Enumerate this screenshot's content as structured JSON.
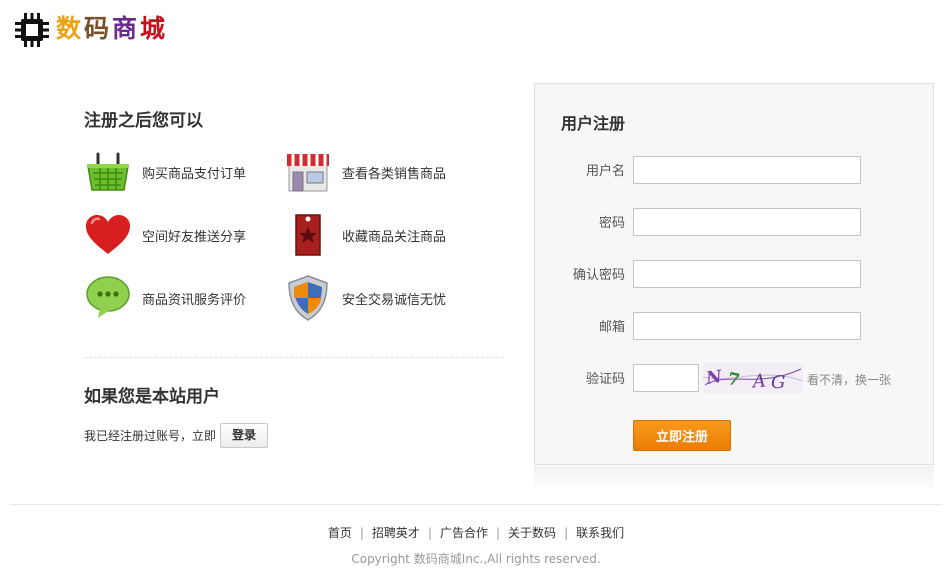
{
  "header": {
    "logo_icon": "chip-icon",
    "logo_chars": [
      "数",
      "码",
      "商",
      "城"
    ]
  },
  "benefits": {
    "title": "注册之后您可以",
    "items": [
      {
        "icon": "shopping-basket-icon",
        "label": "购买商品支付订单"
      },
      {
        "icon": "store-icon",
        "label": "查看各类销售商品"
      },
      {
        "icon": "heart-icon",
        "label": "空间好友推送分享"
      },
      {
        "icon": "bookmark-tag-icon",
        "label": "收藏商品关注商品"
      },
      {
        "icon": "chat-bubble-icon",
        "label": "商品资讯服务评价"
      },
      {
        "icon": "shield-icon",
        "label": "安全交易诚信无忧"
      }
    ]
  },
  "member": {
    "title": "如果您是本站用户",
    "text": "我已经注册过账号，立即",
    "login_label": "登录"
  },
  "register": {
    "title": "用户注册",
    "username_label": "用户名",
    "password_label": "密码",
    "confirm_label": "确认密码",
    "email_label": "邮箱",
    "captcha_label": "验证码",
    "captcha_text": "N7AG",
    "captcha_refresh": "看不清，换一张",
    "submit_label": "立即注册"
  },
  "footer": {
    "links": [
      "首页",
      "招聘英才",
      "广告合作",
      "关于数码",
      "联系我们"
    ],
    "copyright": "Copyright 数码商城Inc.,All rights reserved."
  },
  "colors": {
    "accent": "#f08a0c",
    "panel_bg": "#f7f7f7",
    "border": "#dedede"
  }
}
